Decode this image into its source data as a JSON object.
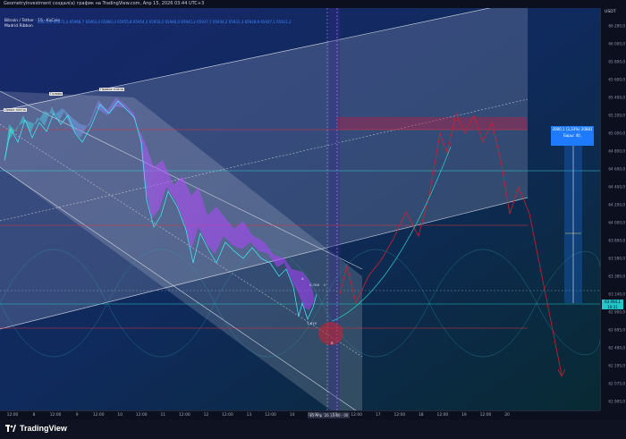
{
  "header": {
    "caption": "GeometryInvestment создал(а) график на TradingView.com, Апр 15, 2026 03:44 UTC+3"
  },
  "legend": {
    "symbol": "Bitcoin / Tether · 15 · KuCoin",
    "indicator": "Madrid Ribbon",
    "values": "65871,4 65871,4 65968,7 65963,4 65860,3 65955,8 65954,3 65950,2 65946,0 65942,2 65937,7 65934,2 65931,3 65928,9 65927,1 65921,2"
  },
  "price_axis": {
    "currency": "USDT",
    "labels": [
      "66 280,0",
      "66 000,0",
      "65 800,0",
      "65 600,0",
      "65 400,0",
      "65 200,0",
      "65 000,0",
      "64 800,0",
      "64 600,0",
      "64 400,0",
      "64 200,0",
      "64 000,0",
      "63 800,0",
      "63 580,0",
      "63 380,0",
      "63 140,0",
      "62 900,0",
      "62 695,0",
      "62 480,0",
      "62 295,0",
      "62 075,0",
      "61 995,0"
    ],
    "current_price": "63 094,1",
    "current_time": "10:31"
  },
  "time_axis": {
    "labels": [
      "12:00",
      "8",
      "12:00",
      "9",
      "12:00",
      "10",
      "12:00",
      "11",
      "12:00",
      "12",
      "12:00",
      "13",
      "12:00",
      "14",
      "12:00",
      "15",
      "12:00",
      "17",
      "12:00",
      "18",
      "12:00",
      "19",
      "12:00",
      "20"
    ],
    "current_date": "15 Апр '26",
    "current_clock": "11:00 · 00"
  },
  "projection_box": {
    "line1": "2080,1 (3,33%) 20881",
    "line2": "Бары: 40,"
  },
  "annotations": {
    "head_left": "Левое плечо",
    "head": "Голова",
    "head_right": "Правое плечо",
    "wave_a": "A",
    "wave_c": "C",
    "wave_b": "B",
    "wave_c_price": "0,706",
    "wave_1_price": "1,619"
  },
  "footer": {
    "brand": "TradingView"
  },
  "colors": {
    "background": "#0b1a3a",
    "channel": "#c7ccd8",
    "ribbon": "#b84dff",
    "ribbon_alt": "#19d3d3",
    "forecast": "#d01f2e",
    "accent_box": "#1e7bff"
  }
}
